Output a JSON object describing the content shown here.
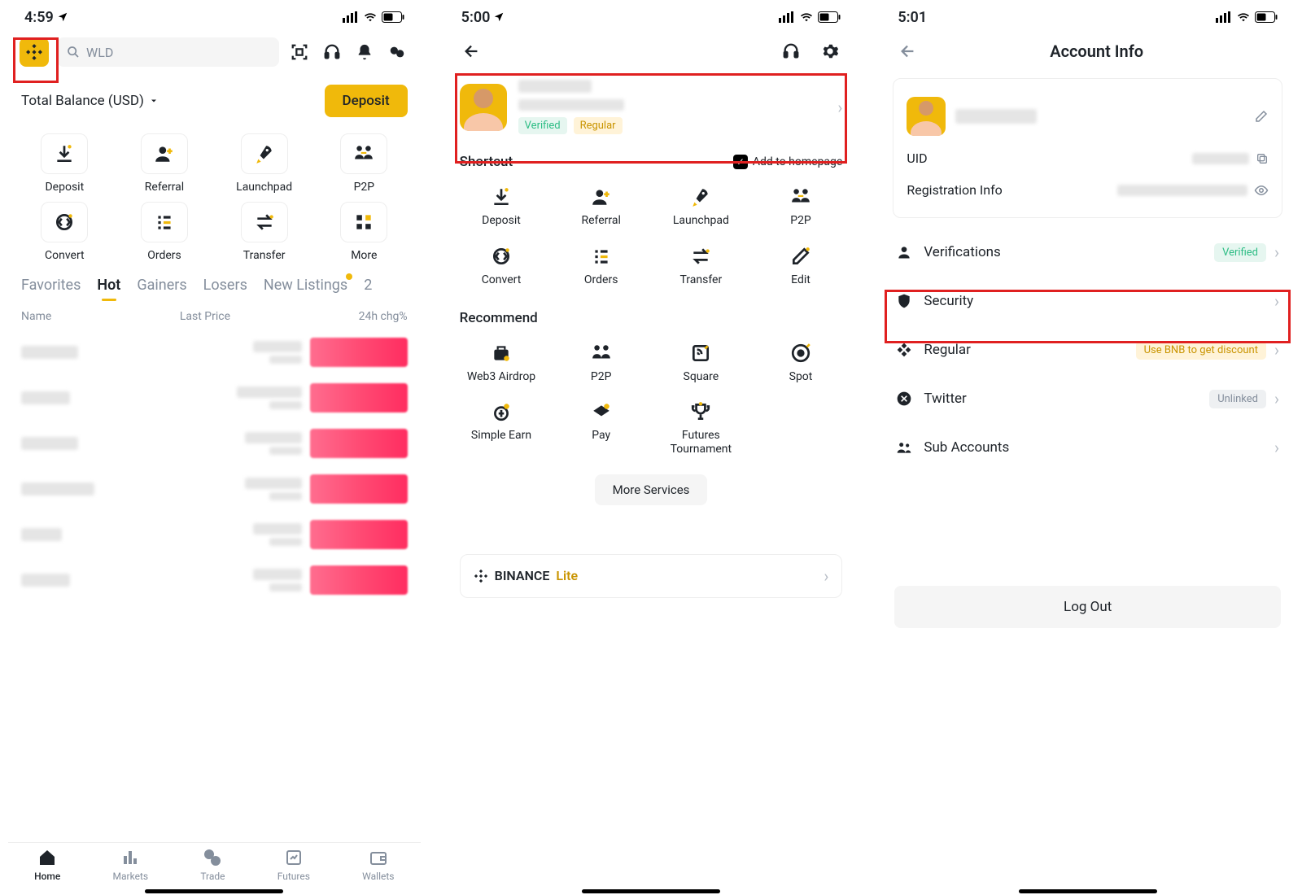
{
  "screen1": {
    "status_time": "4:59",
    "search_placeholder": "WLD",
    "balance_label": "Total Balance (USD)",
    "deposit_button": "Deposit",
    "shortcuts": [
      "Deposit",
      "Referral",
      "Launchpad",
      "P2P",
      "Convert",
      "Orders",
      "Transfer",
      "More"
    ],
    "tabs": [
      "Favorites",
      "Hot",
      "Gainers",
      "Losers",
      "New Listings",
      "2"
    ],
    "active_tab": "Hot",
    "columns": {
      "name": "Name",
      "price": "Last Price",
      "chg": "24h chg%"
    },
    "bottom_nav": [
      "Home",
      "Markets",
      "Trade",
      "Futures",
      "Wallets"
    ],
    "active_nav": "Home"
  },
  "screen2": {
    "status_time": "5:00",
    "badges": {
      "verified": "Verified",
      "regular": "Regular"
    },
    "shortcut_title": "Shortcut",
    "add_homepage": "Add to homepage",
    "shortcuts": [
      "Deposit",
      "Referral",
      "Launchpad",
      "P2P",
      "Convert",
      "Orders",
      "Transfer",
      "Edit"
    ],
    "recommend_title": "Recommend",
    "recommend": [
      "Web3 Airdrop",
      "P2P",
      "Square",
      "Spot",
      "Simple Earn",
      "Pay",
      "Futures Tournament"
    ],
    "more_services": "More Services",
    "lite_brand": "BINANCE",
    "lite_label": "Lite"
  },
  "screen3": {
    "status_time": "5:01",
    "title": "Account Info",
    "uid_label": "UID",
    "reg_label": "Registration Info",
    "rows": {
      "verifications": "Verifications",
      "verifications_status": "Verified",
      "security": "Security",
      "regular": "Regular",
      "regular_pill": "Use BNB to get discount",
      "twitter": "Twitter",
      "twitter_status": "Unlinked",
      "sub": "Sub Accounts"
    },
    "logout": "Log Out"
  }
}
